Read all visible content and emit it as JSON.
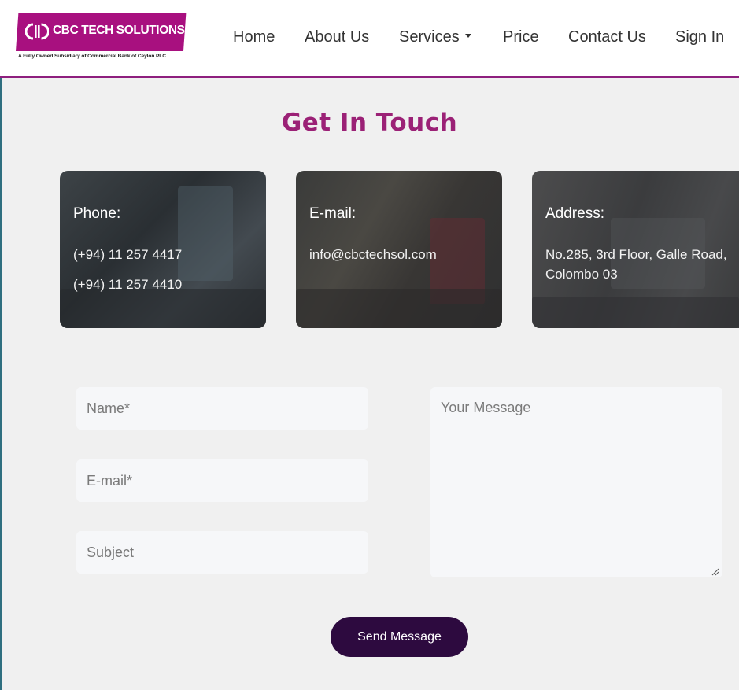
{
  "logo": {
    "name": "CBC TECH SOLUTIONS",
    "tagline": "A Fully Owned Subsidiary of Commercial Bank of Ceylon PLC"
  },
  "nav": {
    "items": [
      "Home",
      "About Us",
      "Services",
      "Price",
      "Contact Us",
      "Sign In"
    ]
  },
  "page": {
    "title": "Get In Touch"
  },
  "cards": {
    "phone": {
      "heading": "Phone:",
      "lines": [
        "(+94) 11 257 4417",
        "(+94) 11 257 4410"
      ]
    },
    "email": {
      "heading": "E-mail:",
      "lines": [
        "info@cbctechsol.com"
      ]
    },
    "address": {
      "heading": "Address:",
      "lines": [
        "No.285, 3rd Floor, Galle Road,",
        "Colombo 03"
      ]
    }
  },
  "form": {
    "name_placeholder": "Name*",
    "email_placeholder": "E-mail*",
    "subject_placeholder": "Subject",
    "message_placeholder": "Your Message",
    "submit_label": "Send Message"
  },
  "colors": {
    "brand": "#a8107f",
    "title": "#9b2176",
    "button": "#2d0a3f",
    "background": "#f0f0f0"
  }
}
